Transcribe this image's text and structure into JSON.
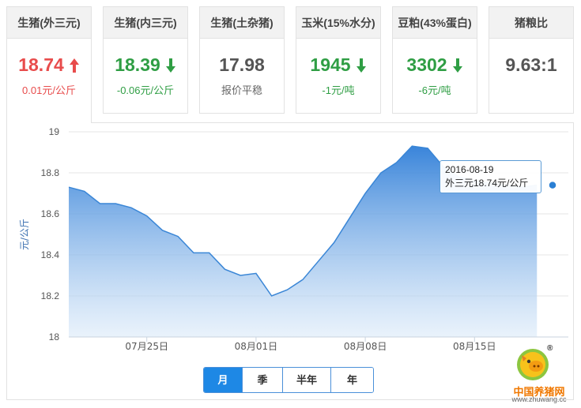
{
  "cards": [
    {
      "title": "生猪(外三元)",
      "price": "18.74",
      "trend": "up",
      "change": "0.01元/公斤",
      "active": true
    },
    {
      "title": "生猪(内三元)",
      "price": "18.39",
      "trend": "down",
      "change": "-0.06元/公斤",
      "active": false
    },
    {
      "title": "生猪(土杂猪)",
      "price": "17.98",
      "trend": "flat",
      "change": "报价平稳",
      "active": false
    },
    {
      "title": "玉米(15%水分)",
      "price": "1945",
      "trend": "down",
      "change": "-1元/吨",
      "active": false
    },
    {
      "title": "豆粕(43%蛋白)",
      "price": "3302",
      "trend": "down",
      "change": "-6元/吨",
      "active": false
    },
    {
      "title": "猪粮比",
      "price": "9.63:1",
      "trend": "flat",
      "change": "",
      "active": false
    }
  ],
  "colors": {
    "up": "#e84c4c",
    "down": "#2f9e44",
    "area_top": "#2f7ed8",
    "area_bottom": "#dbeaf9",
    "point": "#2a7fd4"
  },
  "chart_data": {
    "type": "area",
    "title": "",
    "ylabel": "元/公斤",
    "xlabel": "",
    "ylim": [
      18,
      19
    ],
    "y_ticks": [
      18,
      18.2,
      18.4,
      18.6,
      18.8,
      19
    ],
    "y_tick_labels": [
      "18",
      "18.2",
      "18.4",
      "18.6",
      "18.8",
      "19"
    ],
    "x_tick_labels": [
      "07月25日",
      "08月01日",
      "08月08日",
      "08月15日"
    ],
    "x_tick_dates": [
      "2016-07-25",
      "2016-08-01",
      "2016-08-08",
      "2016-08-15"
    ],
    "x_start": "2016-07-20",
    "x_end": "2016-08-20",
    "series": [
      {
        "points": [
          {
            "x": "2016-07-20",
            "y": 18.73
          },
          {
            "x": "2016-07-21",
            "y": 18.71
          },
          {
            "x": "2016-07-22",
            "y": 18.65
          },
          {
            "x": "2016-07-23",
            "y": 18.65
          },
          {
            "x": "2016-07-24",
            "y": 18.63
          },
          {
            "x": "2016-07-25",
            "y": 18.59
          },
          {
            "x": "2016-07-26",
            "y": 18.52
          },
          {
            "x": "2016-07-27",
            "y": 18.49
          },
          {
            "x": "2016-07-28",
            "y": 18.41
          },
          {
            "x": "2016-07-29",
            "y": 18.41
          },
          {
            "x": "2016-07-30",
            "y": 18.33
          },
          {
            "x": "2016-07-31",
            "y": 18.3
          },
          {
            "x": "2016-08-01",
            "y": 18.31
          },
          {
            "x": "2016-08-02",
            "y": 18.2
          },
          {
            "x": "2016-08-03",
            "y": 18.23
          },
          {
            "x": "2016-08-04",
            "y": 18.28
          },
          {
            "x": "2016-08-05",
            "y": 18.37
          },
          {
            "x": "2016-08-06",
            "y": 18.46
          },
          {
            "x": "2016-08-07",
            "y": 18.58
          },
          {
            "x": "2016-08-08",
            "y": 18.7
          },
          {
            "x": "2016-08-09",
            "y": 18.8
          },
          {
            "x": "2016-08-10",
            "y": 18.85
          },
          {
            "x": "2016-08-11",
            "y": 18.93
          },
          {
            "x": "2016-08-12",
            "y": 18.92
          },
          {
            "x": "2016-08-13",
            "y": 18.83
          },
          {
            "x": "2016-08-14",
            "y": 18.78
          },
          {
            "x": "2016-08-15",
            "y": 18.76
          },
          {
            "x": "2016-08-16",
            "y": 18.75
          },
          {
            "x": "2016-08-17",
            "y": 18.74
          },
          {
            "x": "2016-08-18",
            "y": 18.73
          },
          {
            "x": "2016-08-19",
            "y": 18.74
          }
        ]
      }
    ],
    "highlight": {
      "x": "2016-08-19",
      "y": 18.74
    }
  },
  "tooltip": {
    "date": "2016-08-19",
    "text": "外三元18.74元/公斤"
  },
  "range_buttons": [
    {
      "label": "月",
      "active": true
    },
    {
      "label": "季",
      "active": false
    },
    {
      "label": "半年",
      "active": false
    },
    {
      "label": "年",
      "active": false
    }
  ],
  "logo": {
    "name": "中国养猪网",
    "url": "www.zhuwang.cc",
    "mark": "®"
  }
}
